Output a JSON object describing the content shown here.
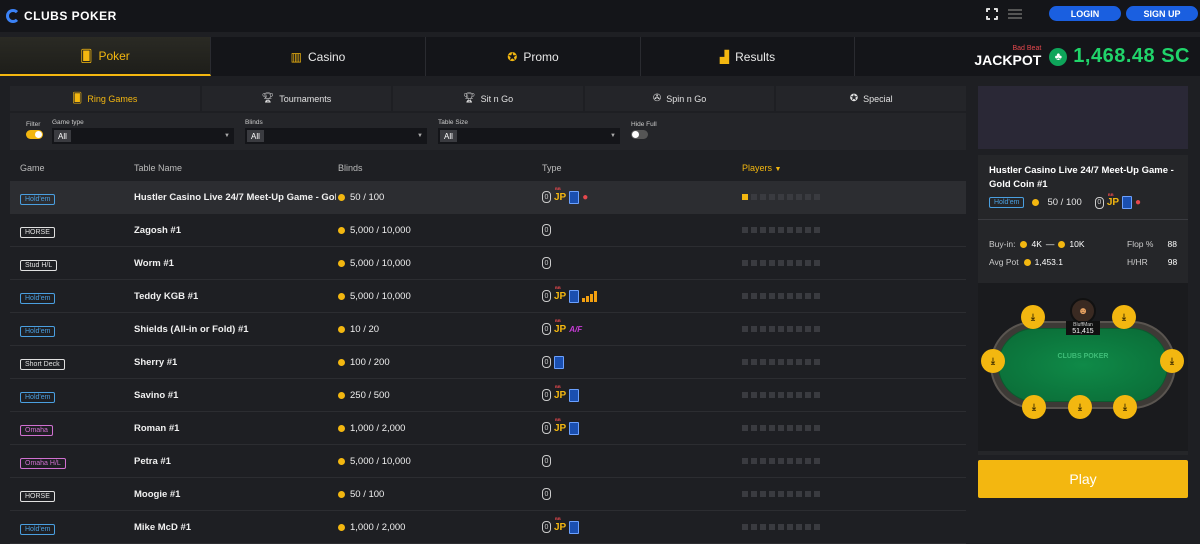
{
  "brand": {
    "name": "CLUBS POKER"
  },
  "header": {
    "login": "LOGIN",
    "signup": "SIGN UP"
  },
  "nav": {
    "tabs": [
      {
        "label": "Poker",
        "icon": "cards-icon"
      },
      {
        "label": "Casino",
        "icon": "slots-icon"
      },
      {
        "label": "Promo",
        "icon": "medal-icon"
      },
      {
        "label": "Results",
        "icon": "bar-chart-icon"
      }
    ],
    "active": "Poker"
  },
  "jackpot": {
    "bad_beat": "Bad Beat",
    "label": "JACKPOT",
    "amount": "1,468.48 SC"
  },
  "subtabs": [
    {
      "label": "Ring Games",
      "icon": "cards-icon"
    },
    {
      "label": "Tournaments",
      "icon": "trophy-icon"
    },
    {
      "label": "Sit n Go",
      "icon": "trophy-icon"
    },
    {
      "label": "Spin n Go",
      "icon": "spin-icon"
    },
    {
      "label": "Special",
      "icon": "star-icon"
    }
  ],
  "filters": {
    "filter_label": "Filter",
    "game_type": {
      "label": "Game type",
      "value": "All"
    },
    "blinds": {
      "label": "Blinds",
      "value": "All"
    },
    "table_size": {
      "label": "Table Size",
      "value": "All"
    },
    "hide_full": {
      "label": "Hide Full"
    }
  },
  "columns": {
    "game": "Game",
    "table_name": "Table Name",
    "blinds": "Blinds",
    "type": "Type",
    "players": "Players"
  },
  "rows": [
    {
      "game": "Hold'em",
      "name": "Hustler Casino Live 24/7 Meet-Up Game - Gol...",
      "blinds": "50 / 100",
      "types": [
        "zero",
        "jp",
        "card",
        "bag"
      ],
      "players": 1,
      "selected": true
    },
    {
      "game": "HORSE",
      "name": "Zagosh #1",
      "blinds": "5,000 / 10,000",
      "types": [
        "zero"
      ],
      "players": 0
    },
    {
      "game": "Stud H/L",
      "name": "Worm #1",
      "blinds": "5,000 / 10,000",
      "types": [
        "zero"
      ],
      "players": 0
    },
    {
      "game": "Hold'em",
      "name": "Teddy KGB #1",
      "blinds": "5,000 / 10,000",
      "types": [
        "zero",
        "jp",
        "card",
        "bars"
      ],
      "players": 0
    },
    {
      "game": "Hold'em",
      "name": "Shields (All-in or Fold) #1",
      "blinds": "10 / 20",
      "types": [
        "zero",
        "jp",
        "af"
      ],
      "players": 0
    },
    {
      "game": "Short Deck",
      "name": "Sherry #1",
      "blinds": "100 / 200",
      "types": [
        "zero",
        "card"
      ],
      "players": 0
    },
    {
      "game": "Hold'em",
      "name": "Savino #1",
      "blinds": "250 / 500",
      "types": [
        "zero",
        "jp",
        "card"
      ],
      "players": 0
    },
    {
      "game": "Omaha",
      "name": "Roman #1",
      "blinds": "1,000 / 2,000",
      "types": [
        "zero",
        "jp",
        "card"
      ],
      "players": 0
    },
    {
      "game": "Omaha H/L",
      "name": "Petra #1",
      "blinds": "5,000 / 10,000",
      "types": [
        "zero"
      ],
      "players": 0
    },
    {
      "game": "HORSE",
      "name": "Moogie #1",
      "blinds": "50 / 100",
      "types": [
        "zero"
      ],
      "players": 0
    },
    {
      "game": "Hold'em",
      "name": "Mike McD #1",
      "blinds": "1,000 / 2,000",
      "types": [
        "zero",
        "jp",
        "card"
      ],
      "players": 0
    }
  ],
  "badge_colors": {
    "Hold'em": "#4a9fe0",
    "HORSE": "#e0e0e0",
    "Stud H/L": "#e0e0e0",
    "Short Deck": "#e0e0e0",
    "Omaha": "#d070d0",
    "Omaha H/L": "#d070d0"
  },
  "details": {
    "title": "Hustler Casino Live 24/7 Meet-Up Game - Gold Coin #1",
    "game": "Hold'em",
    "blinds": "50 / 100",
    "buyin_label": "Buy-in:",
    "buyin_min": "4K",
    "buyin_sep": "—",
    "buyin_max": "10K",
    "avgpot_label": "Avg Pot",
    "avgpot": "1,453.1",
    "flop_label": "Flop %",
    "flop": "88",
    "hhr_label": "H/HR",
    "hhr": "98"
  },
  "table_view": {
    "logo": "CLUBS POKER",
    "player_name": "BluffMan",
    "player_amount": "51,415"
  },
  "play": "Play"
}
